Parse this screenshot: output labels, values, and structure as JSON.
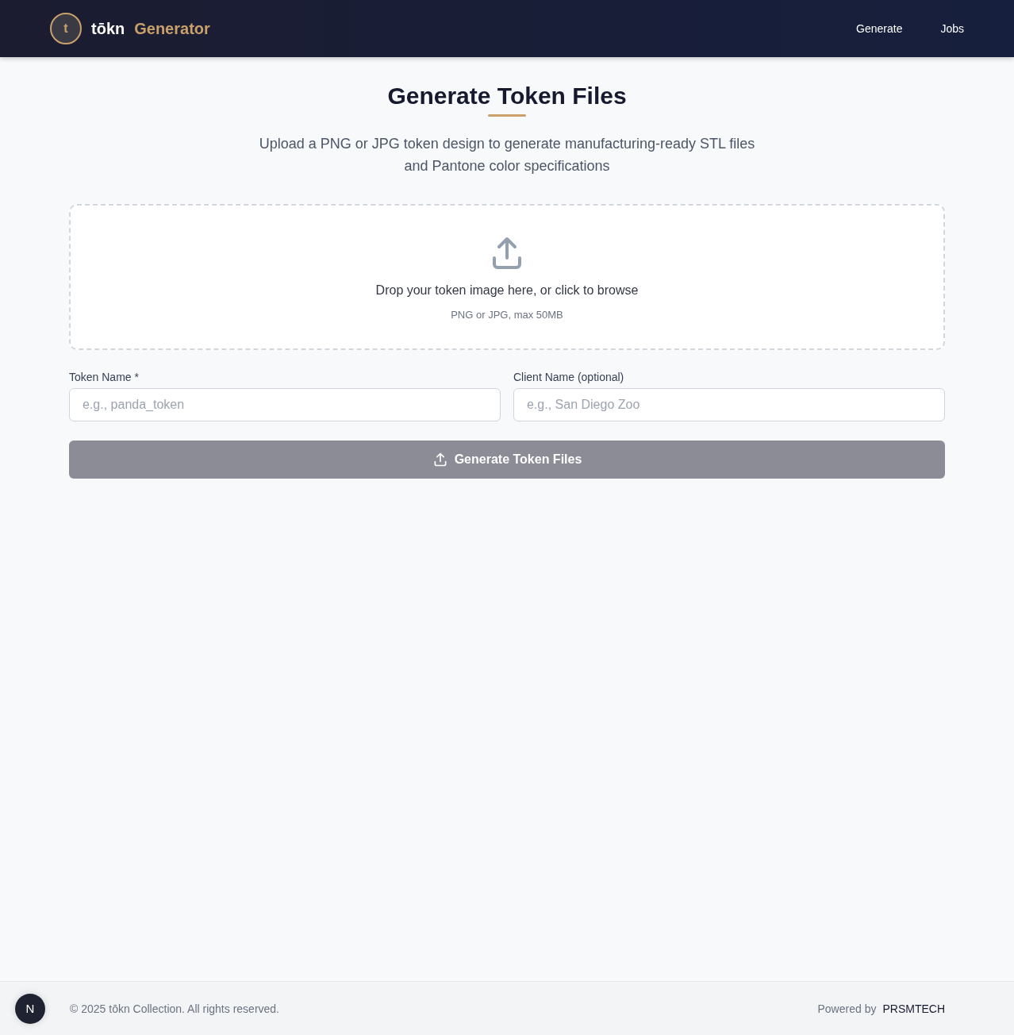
{
  "header": {
    "logo_letter": "t",
    "brand": "tōkn",
    "product": "Generator",
    "nav": [
      "Generate",
      "Jobs"
    ]
  },
  "page": {
    "title": "Generate Token Files",
    "subtitle_lines": [
      "Upload a PNG or JPG token design to generate manufacturing-ready STL files",
      "and Pantone color specifications"
    ]
  },
  "dropzone": {
    "prompt": "Drop your token image here, or click to browse",
    "hint": "PNG or JPG, max 50MB"
  },
  "fields": [
    {
      "label": "Token Name *",
      "placeholder": "e.g., panda_token"
    },
    {
      "label": "Client Name (optional)",
      "placeholder": "e.g., San Diego Zoo"
    }
  ],
  "submit": {
    "label": "Generate Token Files",
    "disabled": true
  },
  "footer": {
    "badge": "N",
    "copyright": "© 2025 tōkn Collection. All rights reserved.",
    "powered_by": "Powered by",
    "company": "PRSMTECH"
  }
}
